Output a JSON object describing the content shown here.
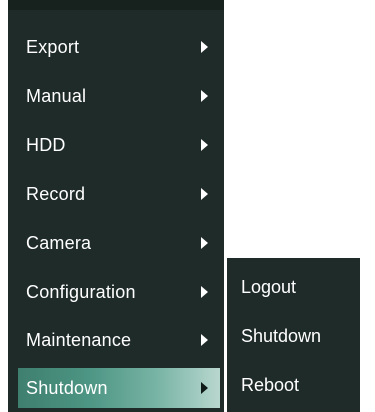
{
  "main_menu": {
    "items": [
      {
        "label": "Export"
      },
      {
        "label": "Manual"
      },
      {
        "label": "HDD"
      },
      {
        "label": "Record"
      },
      {
        "label": "Camera"
      },
      {
        "label": "Configuration"
      },
      {
        "label": "Maintenance"
      },
      {
        "label": "Shutdown",
        "selected": true
      }
    ]
  },
  "sub_menu": {
    "items": [
      {
        "label": "Logout"
      },
      {
        "label": "Shutdown"
      },
      {
        "label": "Reboot"
      }
    ]
  },
  "colors": {
    "menu_background": "#1e2b29",
    "selected_gradient_start": "#3f7f6f",
    "selected_gradient_end": "#b9d7cf",
    "text": "#ffffff"
  },
  "icons": {
    "submenu_arrow": "chevron-right-icon"
  }
}
